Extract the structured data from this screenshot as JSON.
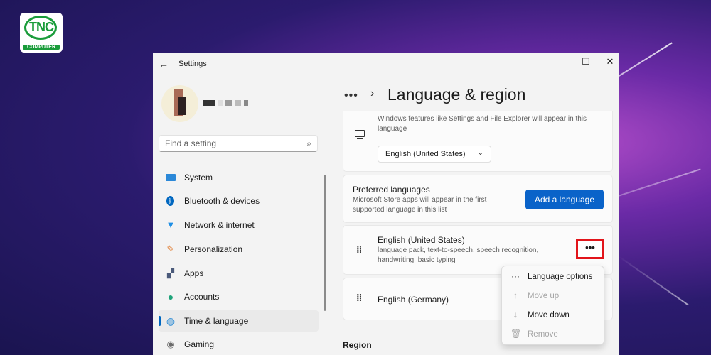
{
  "logo": {
    "brand": "TNC",
    "subtitle": "COMPUTER"
  },
  "window": {
    "title": "Settings",
    "back_icon": "back-arrow-icon",
    "controls": {
      "minimize": "—",
      "maximize": "☐",
      "close": "✕"
    }
  },
  "sidebar": {
    "search_placeholder": "Find a setting",
    "search_icon": "search-icon",
    "items": [
      {
        "label": "System",
        "icon": "system-icon",
        "color": "#2b88d8"
      },
      {
        "label": "Bluetooth & devices",
        "icon": "bluetooth-icon",
        "color": "#0067c0"
      },
      {
        "label": "Network & internet",
        "icon": "wifi-icon",
        "color": "#1f8fe5"
      },
      {
        "label": "Personalization",
        "icon": "brush-icon",
        "color": "#e07a2d"
      },
      {
        "label": "Apps",
        "icon": "apps-icon",
        "color": "#4a5a7a"
      },
      {
        "label": "Accounts",
        "icon": "accounts-icon",
        "color": "#1fa37a"
      },
      {
        "label": "Time & language",
        "icon": "globe-clock-icon",
        "color": "#2a8ad4",
        "active": true
      },
      {
        "label": "Gaming",
        "icon": "gamepad-icon",
        "color": "#6b6b6b"
      }
    ]
  },
  "header": {
    "more": "•••",
    "separator": "›",
    "title": "Language & region"
  },
  "display_language": {
    "description": "Windows features like Settings and File Explorer will appear in this language",
    "selected": "English (United States)",
    "icon": "monitor-icon"
  },
  "preferred": {
    "title": "Preferred languages",
    "description": "Microsoft Store apps will appear in the first supported language in this list",
    "add_button": "Add a language"
  },
  "languages": [
    {
      "name": "English (United States)",
      "features": "language pack, text-to-speech, speech recognition, handwriting, basic typing",
      "more": "•••"
    },
    {
      "name": "English (Germany)"
    }
  ],
  "context_menu": {
    "items": [
      {
        "label": "Language options",
        "icon": "more-icon",
        "glyph": "···",
        "enabled": true
      },
      {
        "label": "Move up",
        "icon": "arrow-up-icon",
        "glyph": "↑",
        "enabled": false
      },
      {
        "label": "Move down",
        "icon": "arrow-down-icon",
        "glyph": "↓",
        "enabled": true
      },
      {
        "label": "Remove",
        "icon": "trash-icon",
        "glyph": "🗑",
        "enabled": false
      }
    ]
  },
  "region": {
    "label": "Region"
  },
  "colors": {
    "accent": "#0a63c9",
    "highlight_box": "#e2151b",
    "window_bg": "#f3f3f3",
    "card_bg": "#fbfbfb"
  }
}
